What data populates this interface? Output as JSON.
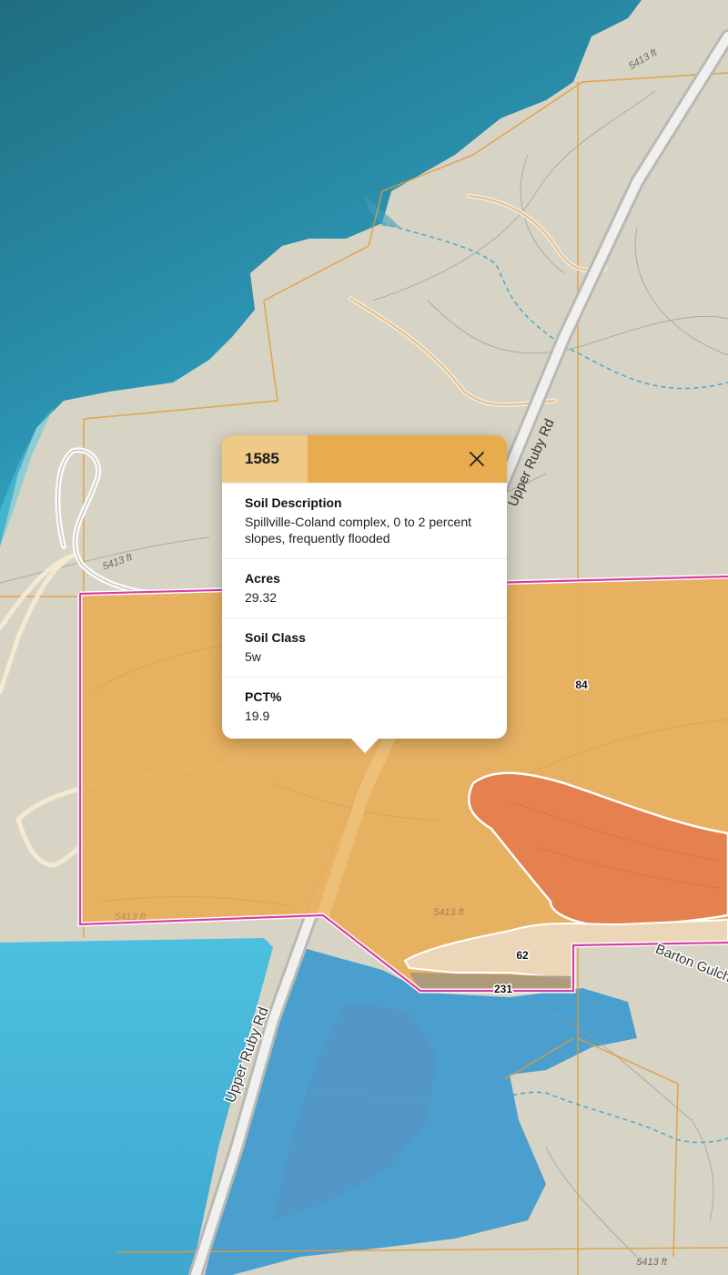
{
  "map": {
    "roads": {
      "upper_ruby_rd_north": "Upper Ruby Rd",
      "upper_ruby_rd_south": "Upper Ruby Rd",
      "barton_gulch": "Barton Gulch"
    },
    "contours": {
      "c1": "5413 ft",
      "c2": "5413 ft",
      "c3": "5413 ft",
      "c4": "5413 ft",
      "c5": "5413 ft"
    },
    "parcel_labels": {
      "p84": "84",
      "p62": "62",
      "p231": "231"
    },
    "colors": {
      "water": "#4fb8d8",
      "land": "#d9d6c8",
      "parcel_fill": "#e8ae5a",
      "parcel_dark": "#e57f4f",
      "parcel_light": "#ecd6b8",
      "boundary": "#d63fa5",
      "survey_line": "#e59a38"
    }
  },
  "popup": {
    "id": "1585",
    "fields": [
      {
        "label": "Soil Description",
        "value": "Spillville-Coland complex, 0 to 2 percent slopes, frequently flooded"
      },
      {
        "label": "Acres",
        "value": "29.32"
      },
      {
        "label": "Soil Class",
        "value": "5w"
      },
      {
        "label": "PCT%",
        "value": "19.9"
      }
    ]
  }
}
